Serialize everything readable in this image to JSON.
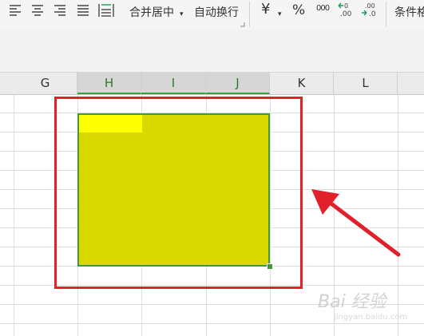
{
  "toolbar": {
    "merge_center_label": "合并居中",
    "wrap_text_label": "自动换行",
    "currency_symbol": "¥",
    "percent_symbol": "%",
    "thousands_symbol": "000",
    "conditional_format_label": "条件格"
  },
  "columns": [
    {
      "label": "G",
      "selected": false
    },
    {
      "label": "H",
      "selected": true
    },
    {
      "label": "I",
      "selected": true
    },
    {
      "label": "J",
      "selected": true
    },
    {
      "label": "K",
      "selected": false
    },
    {
      "label": "L",
      "selected": false
    }
  ],
  "colors": {
    "selection_fill": "#d9d900",
    "active_cell_fill": "#ffff00",
    "selection_border": "#3f9c35",
    "annotation_red": "#e0202a"
  },
  "watermark": {
    "text": "Bai 经验",
    "sub": "jingyan.baidu.com"
  }
}
